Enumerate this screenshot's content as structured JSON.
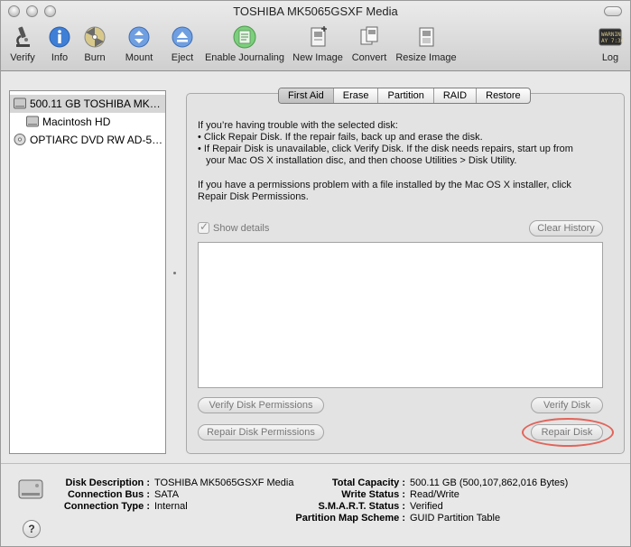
{
  "window": {
    "title": "TOSHIBA MK5065GSXF Media"
  },
  "toolbar": {
    "items": [
      {
        "label": "Verify",
        "icon": "microscope-icon"
      },
      {
        "label": "Info",
        "icon": "info-icon"
      },
      {
        "label": "Burn",
        "icon": "burn-disc-icon"
      },
      {
        "label": "Mount",
        "icon": "mount-icon"
      },
      {
        "label": "Eject",
        "icon": "eject-icon"
      },
      {
        "label": "Enable Journaling",
        "icon": "journaling-icon"
      },
      {
        "label": "New Image",
        "icon": "new-image-icon"
      },
      {
        "label": "Convert",
        "icon": "convert-icon"
      },
      {
        "label": "Resize Image",
        "icon": "resize-image-icon"
      },
      {
        "label": "Log",
        "icon": "log-icon"
      }
    ],
    "log_icon_text": "WARNIN\nAY 7:36"
  },
  "sidebar": {
    "items": [
      {
        "label": "500.11 GB TOSHIBA MK…",
        "icon": "hard-disk-icon",
        "selected": true
      },
      {
        "label": "Macintosh HD",
        "icon": "volume-icon"
      },
      {
        "label": "OPTIARC DVD RW AD-5…",
        "icon": "optical-drive-icon"
      }
    ]
  },
  "tabs": [
    {
      "label": "First Aid",
      "active": true
    },
    {
      "label": "Erase"
    },
    {
      "label": "Partition"
    },
    {
      "label": "RAID"
    },
    {
      "label": "Restore"
    }
  ],
  "first_aid": {
    "intro": "If you’re having trouble with the selected disk:",
    "bullets": [
      "• Click Repair Disk. If the repair fails, back up and erase the disk.",
      "• If Repair Disk is unavailable, click Verify Disk. If the disk needs repairs, start up from",
      "   your Mac OS X installation disc, and then choose Utilities > Disk Utility."
    ],
    "permissions_1": "If you have a permissions problem with a file installed by the Mac OS X installer, click",
    "permissions_2": "Repair Disk Permissions.",
    "show_details": "Show details",
    "clear_history": "Clear History",
    "verify_permissions": "Verify Disk Permissions",
    "repair_permissions": "Repair Disk Permissions",
    "verify_disk": "Verify Disk",
    "repair_disk": "Repair Disk"
  },
  "disk_info": {
    "left": [
      {
        "label": "Disk Description :",
        "value": "TOSHIBA MK5065GSXF Media"
      },
      {
        "label": "Connection Bus :",
        "value": "SATA"
      },
      {
        "label": "Connection Type :",
        "value": "Internal"
      }
    ],
    "right": [
      {
        "label": "Total Capacity :",
        "value": "500.11 GB (500,107,862,016 Bytes)"
      },
      {
        "label": "Write Status :",
        "value": "Read/Write"
      },
      {
        "label": "S.M.A.R.T. Status :",
        "value": "Verified"
      },
      {
        "label": "Partition Map Scheme :",
        "value": "GUID Partition Table"
      }
    ]
  },
  "help_label": "?",
  "colors": {
    "highlight_ring": "#e2645a",
    "info_blue": "#3f7fd6"
  }
}
